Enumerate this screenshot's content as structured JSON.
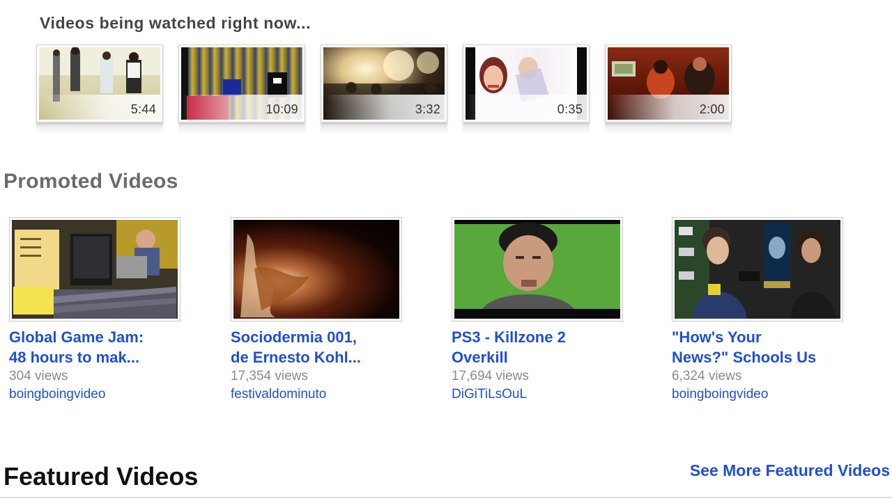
{
  "watched": {
    "heading": "Videos being watched right now...",
    "items": [
      {
        "duration": "5:44"
      },
      {
        "duration": "10:09"
      },
      {
        "duration": "3:32"
      },
      {
        "duration": "0:35"
      },
      {
        "duration": "2:00"
      }
    ]
  },
  "promoted": {
    "heading": "Promoted Videos",
    "items": [
      {
        "title_line1": "Global Game Jam:",
        "title_line2": "48 hours to mak...",
        "views": "304 views",
        "channel": "boingboingvideo"
      },
      {
        "title_line1": "Sociodermia 001,",
        "title_line2": "de Ernesto Kohl...",
        "views": "17,354 views",
        "channel": "festivaldominuto"
      },
      {
        "title_line1": "PS3 - Killzone 2",
        "title_line2": "Overkill",
        "views": "17,694 views",
        "channel": "DiGiTiLsOuL"
      },
      {
        "title_line1": "\"How's Your",
        "title_line2": "News?\" Schools Us",
        "views": "6,324 views",
        "channel": "boingboingvideo"
      }
    ]
  },
  "featured": {
    "heading": "Featured Videos",
    "see_more": "See More Featured Videos"
  },
  "colors": {
    "link": "#1f4fd1",
    "views": "#8a8a8a",
    "heading_gray": "#6b6b6b"
  }
}
